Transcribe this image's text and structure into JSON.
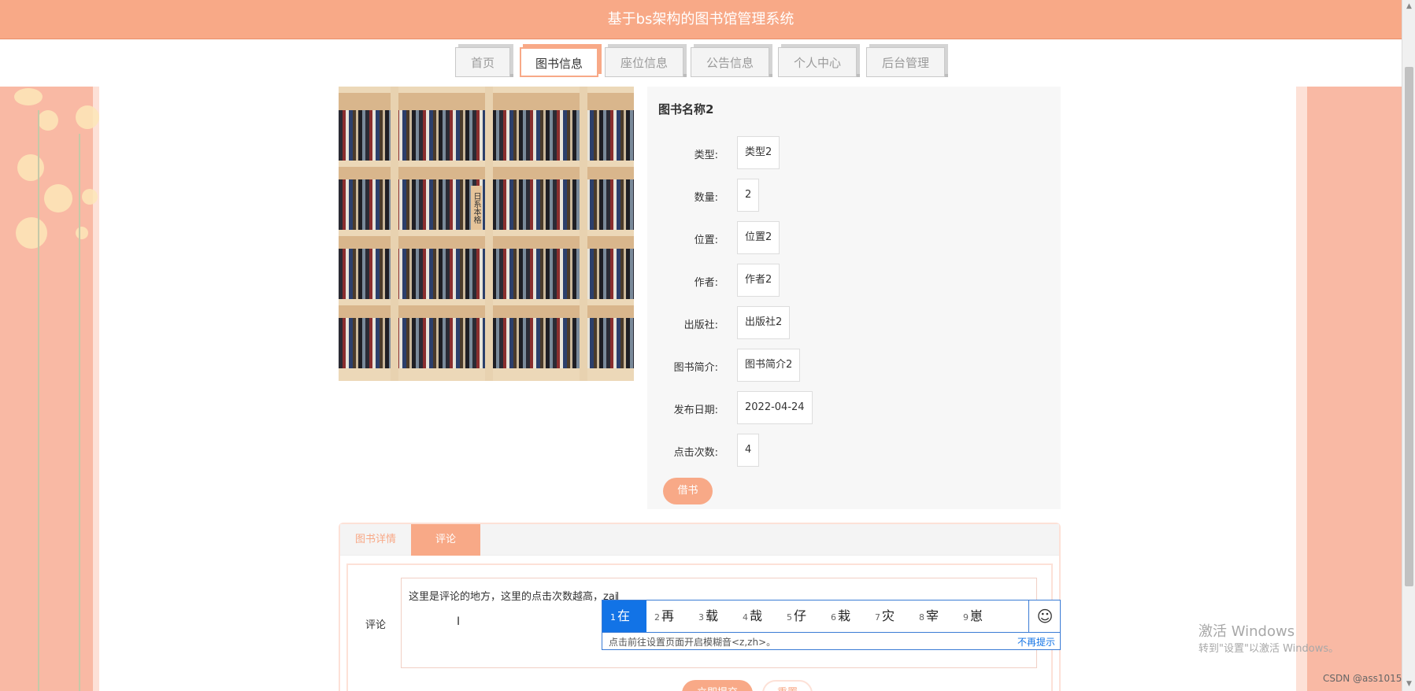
{
  "header": {
    "title": "基于bs架构的图书馆管理系统"
  },
  "nav": {
    "tabs": [
      {
        "label": "首页",
        "active": false
      },
      {
        "label": "图书信息",
        "active": true
      },
      {
        "label": "座位信息",
        "active": false
      },
      {
        "label": "公告信息",
        "active": false
      },
      {
        "label": "个人中心",
        "active": false
      },
      {
        "label": "后台管理",
        "active": false
      }
    ]
  },
  "book": {
    "image_sign": "日系本格",
    "title": "图书名称2",
    "fields": [
      {
        "label": "类型:",
        "value": "类型2"
      },
      {
        "label": "数量:",
        "value": "2"
      },
      {
        "label": "位置:",
        "value": "位置2"
      },
      {
        "label": "作者:",
        "value": "作者2"
      },
      {
        "label": "出版社:",
        "value": "出版社2"
      },
      {
        "label": "图书简介:",
        "value": "图书简介2"
      },
      {
        "label": "发布日期:",
        "value": "2022-04-24"
      },
      {
        "label": "点击次数:",
        "value": "4"
      }
    ],
    "borrow_label": "借书"
  },
  "detail_tabs": {
    "details_label": "图书详情",
    "comments_label": "评论"
  },
  "comment_form": {
    "label": "评论",
    "text": "这里是评论的地方，这里的点击次数越高，",
    "composing": "zai",
    "submit_label": "立即提交",
    "reset_label": "重置"
  },
  "ime": {
    "candidates": [
      {
        "num": "1",
        "char": "在"
      },
      {
        "num": "2",
        "char": "再"
      },
      {
        "num": "3",
        "char": "载"
      },
      {
        "num": "4",
        "char": "哉"
      },
      {
        "num": "5",
        "char": "仔"
      },
      {
        "num": "6",
        "char": "栽"
      },
      {
        "num": "7",
        "char": "灾"
      },
      {
        "num": "8",
        "char": "宰"
      },
      {
        "num": "9",
        "char": "崽"
      }
    ],
    "emoji_icon": "smiley-icon",
    "hint": "点击前往设置页面开启模糊音<z,zh>。",
    "dismiss_label": "不再提示"
  },
  "watermark": {
    "activate_title": "激活 Windows",
    "activate_sub": "转到\"设置\"以激活 Windows。",
    "csdn": "CSDN @ass1015"
  },
  "colors": {
    "accent": "#f8a987",
    "ime_blue": "#1273e6"
  }
}
